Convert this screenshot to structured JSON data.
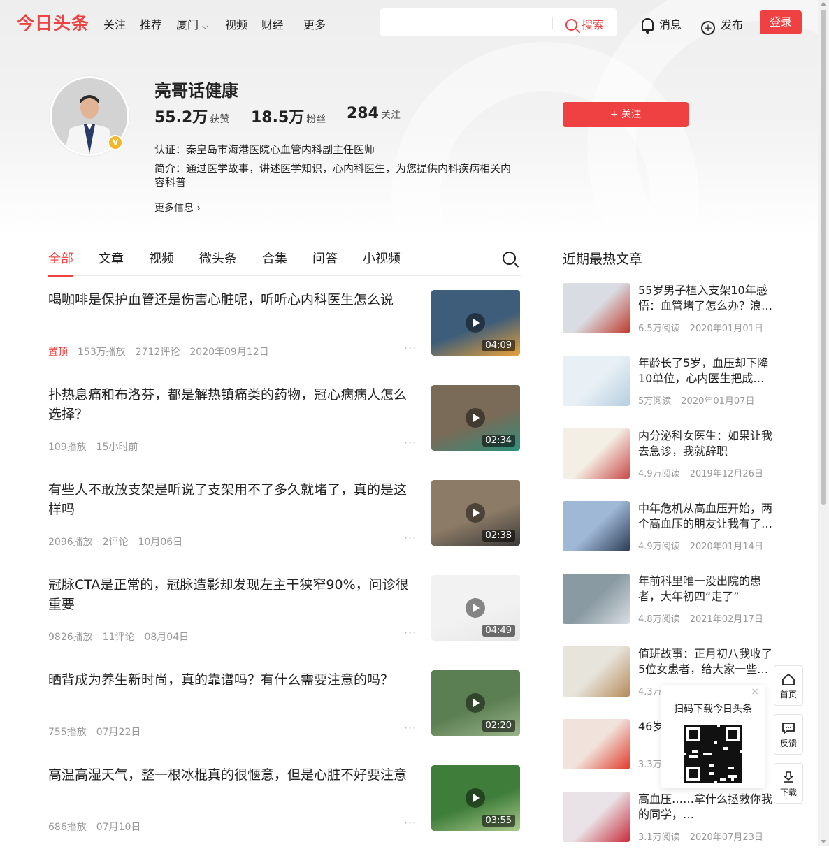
{
  "app": {
    "logo": "今日头条"
  },
  "nav": {
    "items": [
      "关注",
      "推荐",
      "厦门",
      "视频",
      "财经",
      "更多"
    ],
    "search_button": "搜索",
    "search_placeholder": "",
    "messages": "消息",
    "publish": "发布",
    "login": "登录"
  },
  "profile": {
    "name": "亮哥话健康",
    "likes_num": "55.2万",
    "likes_label": "获赞",
    "fans_num": "18.5万",
    "fans_label": "粉丝",
    "following_num": "284",
    "following_label": "关注",
    "follow_button": "+ 关注",
    "certification": "认证：秦皇岛市海港医院心血管内科副主任医师",
    "intro": "简介：通过医学故事，讲述医学知识，心内科医生，为您提供内科疾病相关内容科普",
    "more_info": "更多信息"
  },
  "tabs": [
    "全部",
    "文章",
    "视频",
    "微头条",
    "合集",
    "问答",
    "小视频"
  ],
  "feed": [
    {
      "title": "喝咖啡是保护血管还是伤害心脏呢，听听心内科医生怎么说",
      "pin": "置顶",
      "plays": "153万播放",
      "comments": "2712评论",
      "date": "2020年09月12日",
      "duration": "04:09",
      "colors": [
        "#3e5d7a",
        "#e8a13a"
      ]
    },
    {
      "title": "扑热息痛和布洛芬，都是解热镇痛类的药物，冠心病病人怎么选择？",
      "pin": "",
      "plays": "109播放",
      "comments": "",
      "date": "15小时前",
      "duration": "02:34",
      "colors": [
        "#7a6a58",
        "#2e8f7a"
      ]
    },
    {
      "title": "有些人不敢放支架是听说了支架用不了多久就堵了，真的是这样吗",
      "pin": "",
      "plays": "2096播放",
      "comments": "2评论",
      "date": "10月06日",
      "duration": "02:38",
      "colors": [
        "#8c7b66",
        "#3a3a3a"
      ]
    },
    {
      "title": "冠脉CTA是正常的，冠脉造影却发现左主干狭窄90%，问诊很重要",
      "pin": "",
      "plays": "9826播放",
      "comments": "11评论",
      "date": "08月04日",
      "duration": "04:49",
      "colors": [
        "#f2f2f2",
        "#e6e6e6"
      ]
    },
    {
      "title": "晒背成为养生新时尚，真的靠谱吗？有什么需要注意的吗？",
      "pin": "",
      "plays": "755播放",
      "comments": "",
      "date": "07月22日",
      "duration": "02:20",
      "colors": [
        "#5b7f52",
        "#9bb48a"
      ]
    },
    {
      "title": "高温高湿天气，整一根冰棍真的很惬意，但是心脏不好要注意",
      "pin": "",
      "plays": "686播放",
      "comments": "",
      "date": "07月10日",
      "duration": "03:55",
      "colors": [
        "#3f7d3a",
        "#a8c98c"
      ]
    }
  ],
  "sidebar": {
    "title": "近期最热文章",
    "articles": [
      {
        "title": "55岁男子植入支架10年感悟：血管堵了怎么办？浪…",
        "reads": "6.5万阅读",
        "date": "2020年01月01日",
        "colors": [
          "#d9dde3",
          "#c0392b"
        ]
      },
      {
        "title": "年龄长了5岁，血压却下降10单位，心内医生把成…",
        "reads": "5万阅读",
        "date": "2020年01月07日",
        "colors": [
          "#e9f0f5",
          "#b6cfe0"
        ]
      },
      {
        "title": "内分泌科女医生：如果让我去急诊，我就辞职",
        "reads": "4.9万阅读",
        "date": "2019年12月26日",
        "colors": [
          "#f4efe4",
          "#c94a4a"
        ]
      },
      {
        "title": "中年危机从高血压开始，两个高血压的朋友让我有了…",
        "reads": "4.9万阅读",
        "date": "2020年01月14日",
        "colors": [
          "#9fb8d6",
          "#2b3a55"
        ]
      },
      {
        "title": "年前科里唯一没出院的患者，大年初四“走了”",
        "reads": "4.8万阅读",
        "date": "2021年02月17日",
        "colors": [
          "#8a9aa3",
          "#d8dee2"
        ]
      },
      {
        "title": "值班故事：正月初八我收了5位女患者，给大家一些…",
        "reads": "4.3万阅读",
        "date": "",
        "colors": [
          "#e7e4dc",
          "#b58a5a"
        ]
      },
      {
        "title": "46岁……是颈椎…",
        "reads": "3.3万阅读",
        "date": "",
        "colors": [
          "#f1e3dc",
          "#e03b2a"
        ]
      },
      {
        "title": "高血压……拿什么拯救你我的同学，…",
        "reads": "3.1万阅读",
        "date": "2020年07月23日",
        "colors": [
          "#e9e2e6",
          "#c72b3b"
        ]
      }
    ]
  },
  "qr_popup": {
    "title": "扫码下载今日头条",
    "close": "×"
  },
  "float": {
    "home": "首页",
    "feedback": "反馈",
    "download": "下载"
  }
}
